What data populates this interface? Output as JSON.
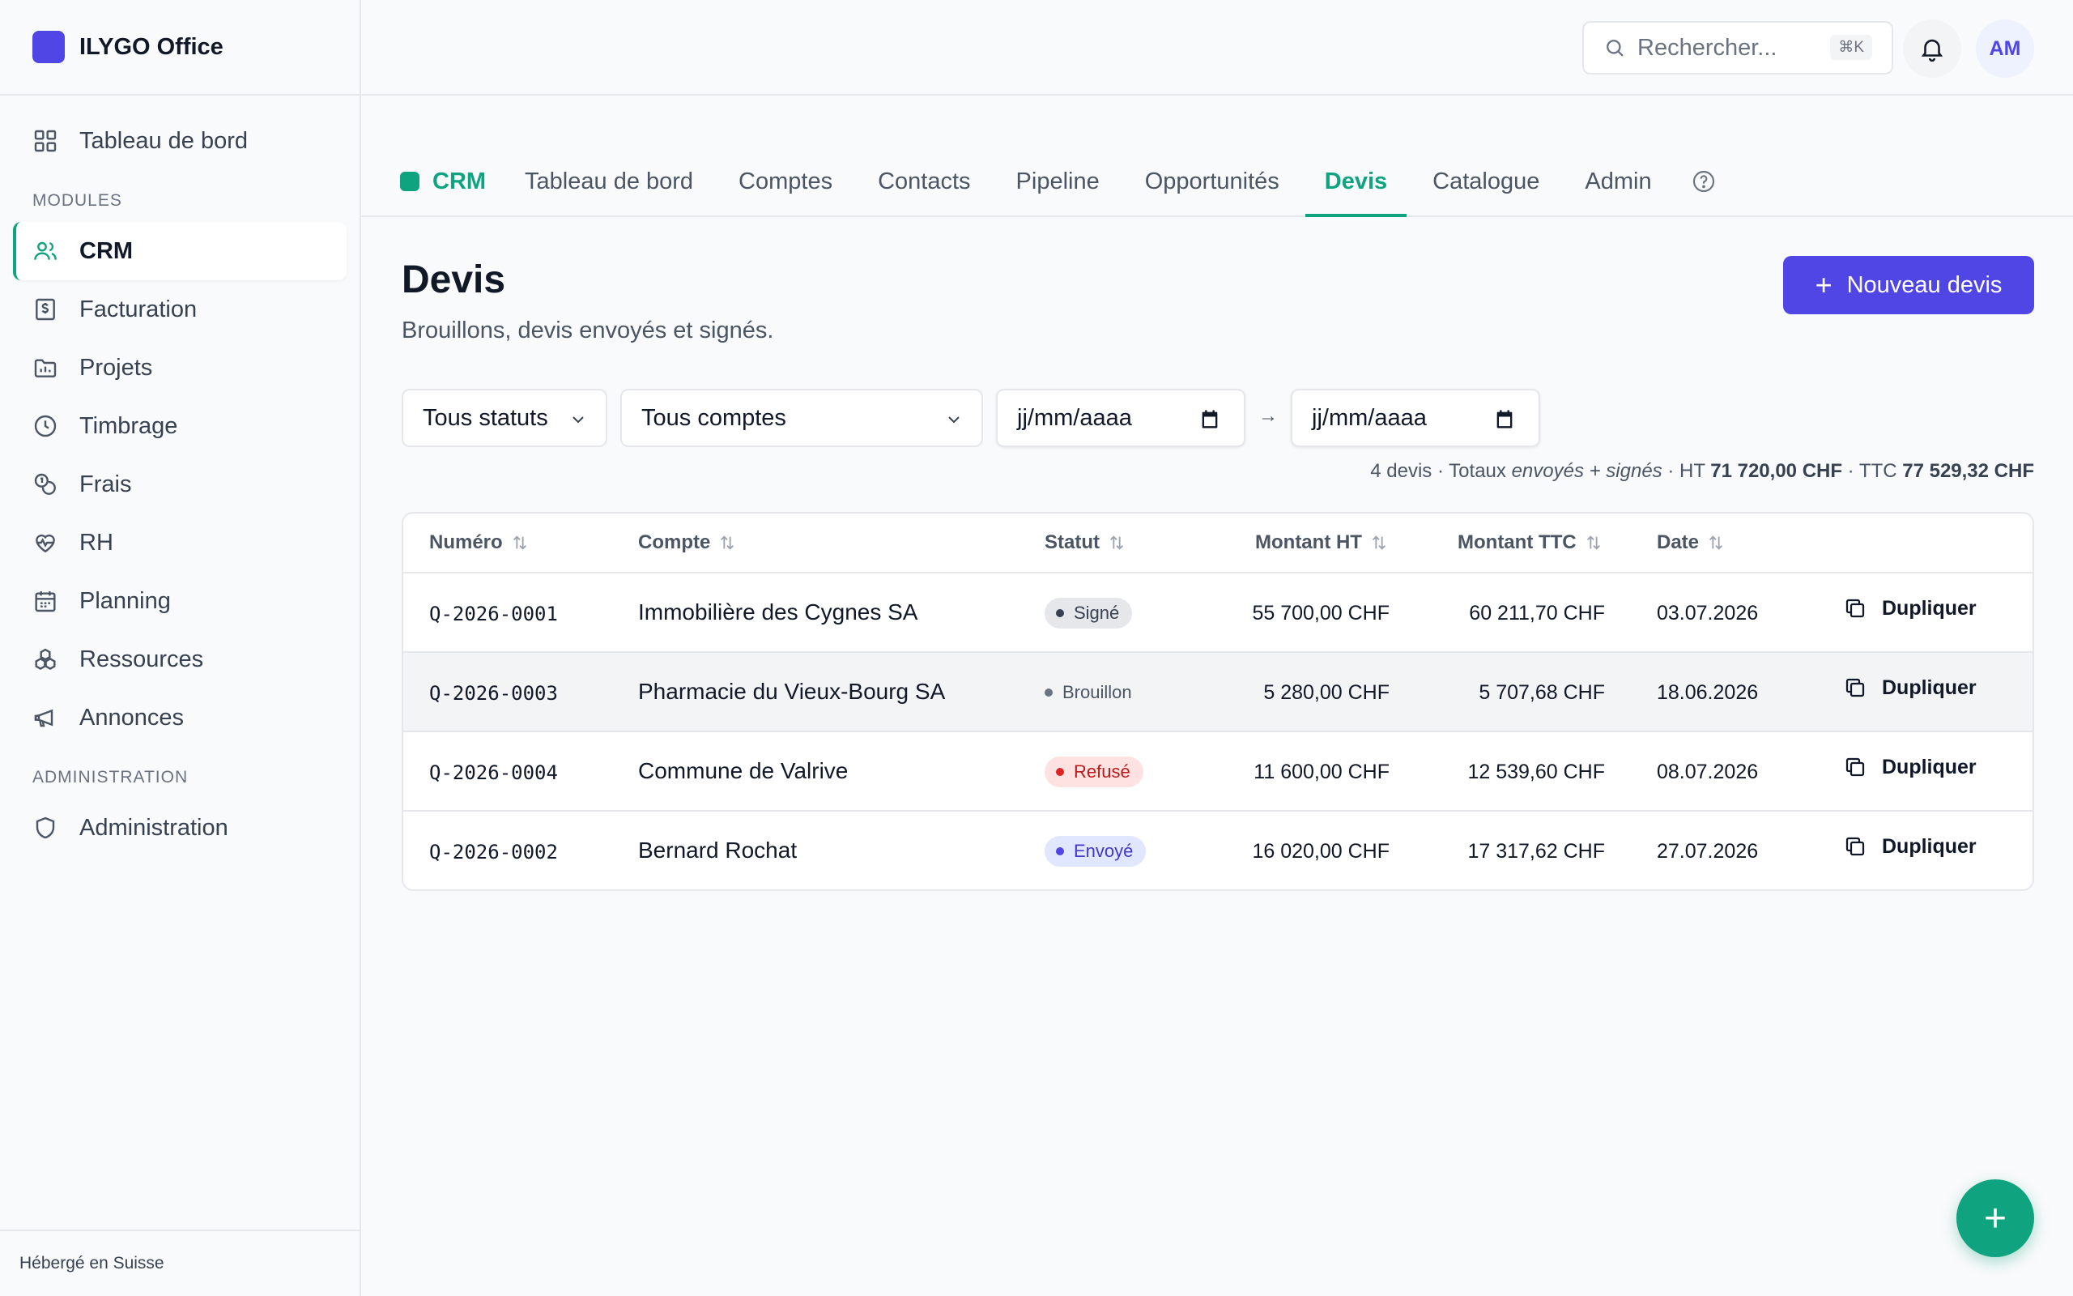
{
  "brand": {
    "name": "ILYGO Office",
    "color": "#5046e5"
  },
  "sidebar": {
    "top_item": {
      "label": "Tableau de bord",
      "icon": "grid-icon"
    },
    "modules_heading": "MODULES",
    "modules": [
      {
        "label": "CRM",
        "icon": "users-icon",
        "active": true
      },
      {
        "label": "Facturation",
        "icon": "invoice-icon"
      },
      {
        "label": "Projets",
        "icon": "folder-icon"
      },
      {
        "label": "Timbrage",
        "icon": "clock-icon"
      },
      {
        "label": "Frais",
        "icon": "coins-icon"
      },
      {
        "label": "RH",
        "icon": "heart-pulse-icon"
      },
      {
        "label": "Planning",
        "icon": "calendar-icon"
      },
      {
        "label": "Ressources",
        "icon": "boxes-icon"
      },
      {
        "label": "Annonces",
        "icon": "megaphone-icon"
      }
    ],
    "admin_heading": "ADMINISTRATION",
    "admin_items": [
      {
        "label": "Administration",
        "icon": "shield-icon"
      }
    ],
    "footer": "Hébergé en Suisse"
  },
  "topbar": {
    "search_placeholder": "Rechercher...",
    "search_shortcut": "⌘K",
    "avatar_initials": "AM"
  },
  "module_tabs": {
    "module": "CRM",
    "accent": "#10a37f",
    "tabs": [
      "Tableau de bord",
      "Comptes",
      "Contacts",
      "Pipeline",
      "Opportunités",
      "Devis",
      "Catalogue",
      "Admin"
    ],
    "active": "Devis"
  },
  "page": {
    "title": "Devis",
    "subtitle": "Brouillons, devis envoyés et signés.",
    "new_button": "Nouveau devis"
  },
  "filters": {
    "status": "Tous statuts",
    "account": "Tous comptes",
    "date_from": "jj/mm/aaaa",
    "date_to": "jj/mm/aaaa",
    "arrow": "→"
  },
  "summary": {
    "count": "4 devis · Totaux ",
    "scope": "envoyés + signés",
    "ht_label": " · HT ",
    "ht_value": "71 720,00 CHF",
    "ttc_label": " · TTC ",
    "ttc_value": "77 529,32 CHF"
  },
  "table": {
    "columns": [
      "Numéro",
      "Compte",
      "Statut",
      "Montant HT",
      "Montant TTC",
      "Date"
    ],
    "action_label": "Dupliquer",
    "rows": [
      {
        "number": "Q-2026-0001",
        "account": "Immobilière des Cygnes SA",
        "status": "Signé",
        "ht": "55 700,00 CHF",
        "ttc": "60 211,70 CHF",
        "date": "03.07.2026"
      },
      {
        "number": "Q-2026-0003",
        "account": "Pharmacie du Vieux-Bourg SA",
        "status": "Brouillon",
        "ht": "5 280,00 CHF",
        "ttc": "5 707,68 CHF",
        "date": "18.06.2026"
      },
      {
        "number": "Q-2026-0004",
        "account": "Commune de Valrive",
        "status": "Refusé",
        "ht": "11 600,00 CHF",
        "ttc": "12 539,60 CHF",
        "date": "08.07.2026"
      },
      {
        "number": "Q-2026-0002",
        "account": "Bernard Rochat",
        "status": "Envoyé",
        "ht": "16 020,00 CHF",
        "ttc": "17 317,62 CHF",
        "date": "27.07.2026"
      }
    ],
    "status_colors": {
      "Signé": {
        "bg": "#e5e7eb",
        "fg": "#374151",
        "dot": "#374151"
      },
      "Brouillon": {
        "bg": "transparent",
        "fg": "#4b5563",
        "dot": "#6b7280"
      },
      "Refusé": {
        "bg": "#fee2e2",
        "fg": "#b91c1c",
        "dot": "#dc2626"
      },
      "Envoyé": {
        "bg": "#e0e7ff",
        "fg": "#4338ca",
        "dot": "#4f46e5"
      }
    }
  },
  "fab": {
    "label": "+"
  }
}
